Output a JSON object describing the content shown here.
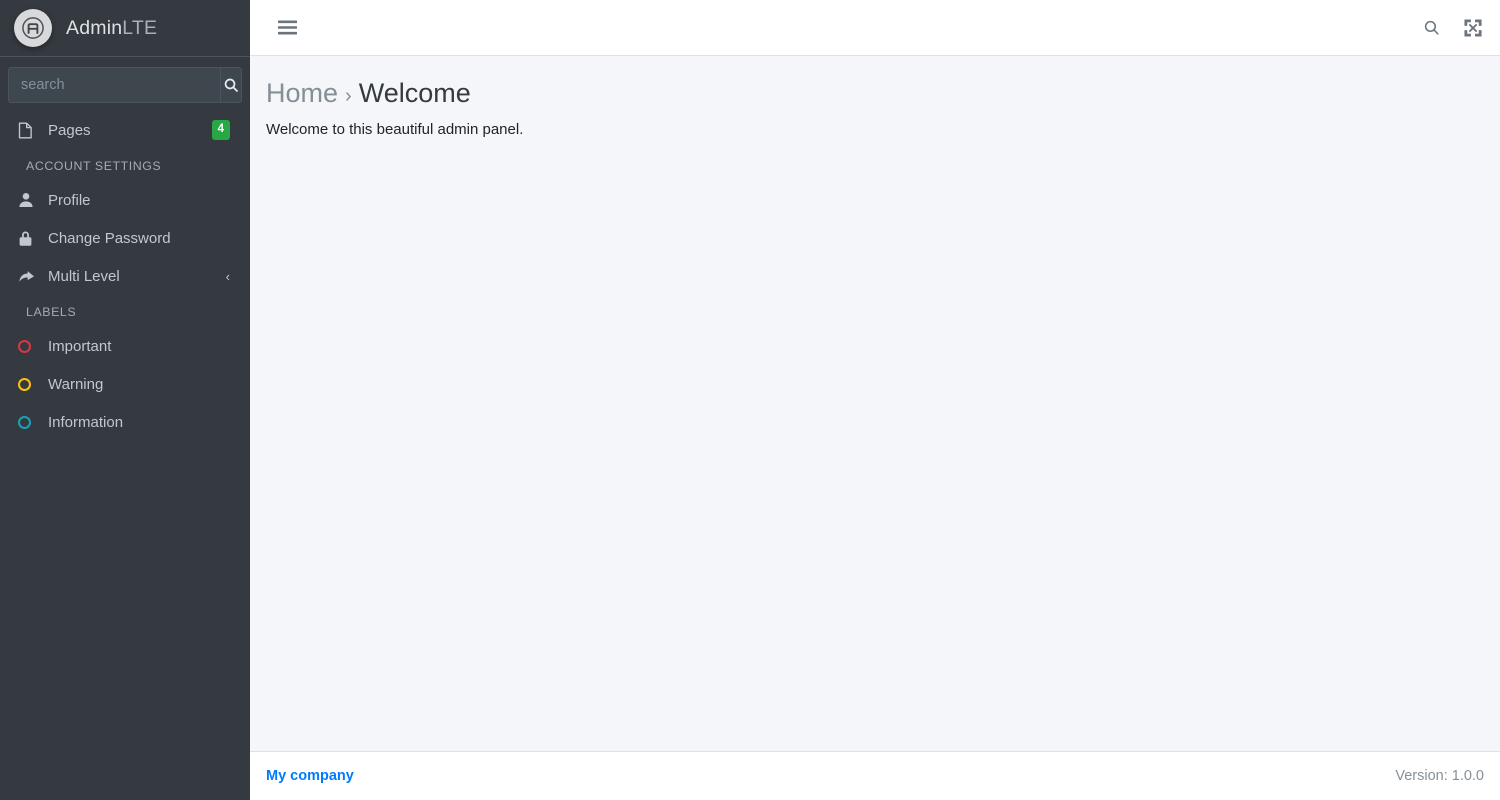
{
  "brand": {
    "logo_icon": "adminlte-circle-logo",
    "name_bold": "Admin",
    "name_light": "LTE"
  },
  "sidebar": {
    "search": {
      "placeholder": "search",
      "value": "",
      "button_icon": "search-icon"
    },
    "items": [
      {
        "label": "Pages",
        "icon": "file-icon",
        "badge": "4"
      }
    ],
    "sections": [
      {
        "header": "ACCOUNT SETTINGS",
        "items": [
          {
            "label": "Profile",
            "icon": "user-icon"
          },
          {
            "label": "Change Password",
            "icon": "lock-icon"
          },
          {
            "label": "Multi Level",
            "icon": "share-icon",
            "chevron": "‹"
          }
        ]
      },
      {
        "header": "LABELS",
        "items": [
          {
            "label": "Important",
            "icon": "circle-outline-icon",
            "color": "#dc3545"
          },
          {
            "label": "Warning",
            "icon": "circle-outline-icon",
            "color": "#ffc107"
          },
          {
            "label": "Information",
            "icon": "circle-outline-icon",
            "color": "#17a2b8"
          }
        ]
      }
    ]
  },
  "navbar": {
    "menu_toggle_icon": "hamburger-icon",
    "search_icon": "search-icon",
    "fullscreen_icon": "expand-arrows-icon"
  },
  "content": {
    "breadcrumb": {
      "home": "Home",
      "separator": "›",
      "active": "Welcome"
    },
    "body_text": "Welcome to this beautiful admin panel."
  },
  "footer": {
    "company_link": "My company",
    "version": "Version: 1.0.0"
  },
  "colors": {
    "sidebar_bg": "#343a40",
    "content_bg": "#f4f6f9",
    "navbar_bg": "#ffffff",
    "badge_green": "#28a745",
    "link_blue": "#007bff",
    "important_red": "#dc3545",
    "warning_yellow": "#ffc107",
    "info_cyan": "#17a2b8"
  }
}
